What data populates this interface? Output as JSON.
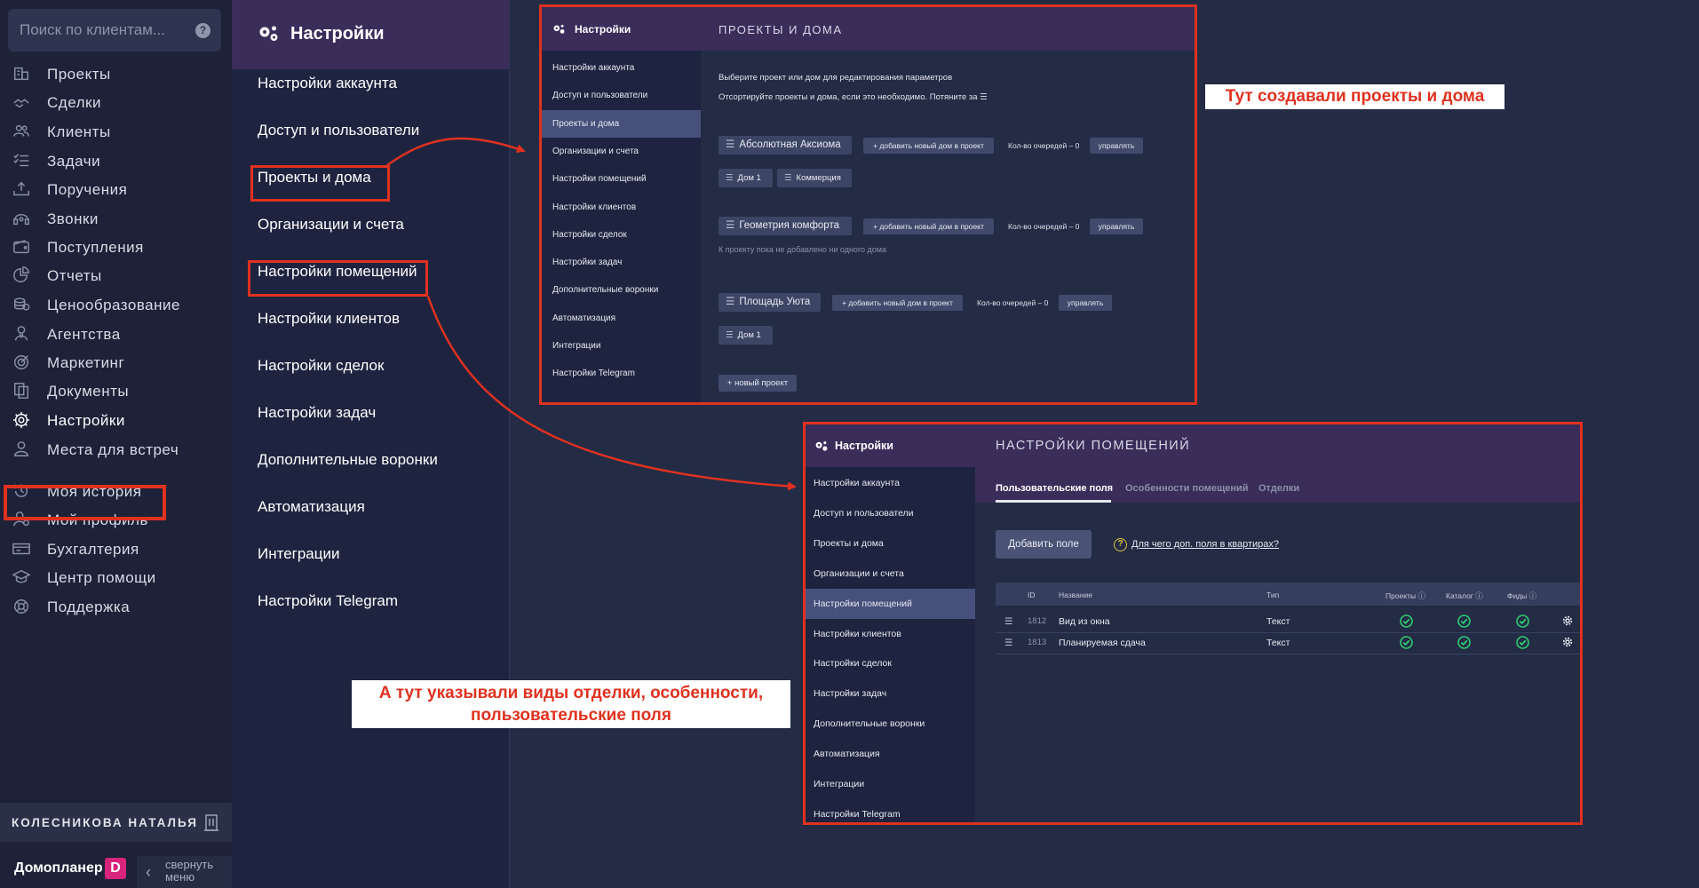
{
  "search": {
    "placeholder": "Поиск по клиентам..."
  },
  "nav": {
    "items": [
      {
        "label": "Проекты",
        "icon": "building-icon"
      },
      {
        "label": "Сделки",
        "icon": "handshake-icon"
      },
      {
        "label": "Клиенты",
        "icon": "users-icon"
      },
      {
        "label": "Задачи",
        "icon": "checklist-icon"
      },
      {
        "label": "Поручения",
        "icon": "upload-tray-icon"
      },
      {
        "label": "Звонки",
        "icon": "headset-icon"
      },
      {
        "label": "Поступления",
        "icon": "wallet-icon"
      },
      {
        "label": "Отчеты",
        "icon": "pie-chart-icon"
      },
      {
        "label": "Ценообразование",
        "icon": "coins-icon"
      },
      {
        "label": "Агентства",
        "icon": "agent-icon"
      },
      {
        "label": "Маркетинг",
        "icon": "target-icon"
      },
      {
        "label": "Документы",
        "icon": "documents-icon"
      },
      {
        "label": "Настройки",
        "icon": "gear-icon"
      },
      {
        "label": "Места для встреч",
        "icon": "meeting-icon"
      },
      {
        "label": "Моя история",
        "icon": "history-icon"
      },
      {
        "label": "Мой профиль",
        "icon": "profile-icon"
      },
      {
        "label": "Бухгалтерия",
        "icon": "cash-icon"
      },
      {
        "label": "Центр помощи",
        "icon": "graduation-cap-icon"
      },
      {
        "label": "Поддержка",
        "icon": "lifebuoy-icon"
      }
    ],
    "active": "Настройки"
  },
  "user": {
    "name": "КОЛЕСНИКОВА НАТАЛЬЯ"
  },
  "brand": {
    "name": "Домопланер",
    "logo_letter": "D",
    "collapse_label_1": "свернуть",
    "collapse_label_2": "меню"
  },
  "settings": {
    "title": "Настройки",
    "items": [
      "Настройки аккаунта",
      "Доступ и пользователи",
      "Проекты и дома",
      "Организации и счета",
      "Настройки помещений",
      "Настройки клиентов",
      "Настройки сделок",
      "Настройки задач",
      "Дополнительные воронки",
      "Автоматизация",
      "Интеграции",
      "Настройки Telegram"
    ]
  },
  "panel1": {
    "sidebar_title": "Настройки",
    "selected_item": "Проекты и дома",
    "header": "ПРОЕКТЫ И ДОМА",
    "intro_1": "Выберите проект или дом для редактирования параметров",
    "intro_2": "Отсортируйте проекты и дома, если это необходимо. Потяните за ☰",
    "add_house_label": "+ добавить новый дом в проект",
    "queue_label": "Кол-во очередей – 0",
    "manage_label": "управлять",
    "empty_note": "К проекту пока не добавлено ни одного дома",
    "new_project_label": "+ новый проект",
    "projects": [
      {
        "name": "Абсолютная Аксиома",
        "houses": [
          "Дом 1",
          "Коммерция"
        ]
      },
      {
        "name": "Геометрия комфорта",
        "houses": []
      },
      {
        "name": "Площадь Уюта",
        "houses": [
          "Дом 1"
        ]
      }
    ]
  },
  "panel2": {
    "sidebar_title": "Настройки",
    "selected_item": "Настройки помещений",
    "header": "НАСТРОЙКИ ПОМЕЩЕНИЙ",
    "tabs": [
      "Пользовательские поля",
      "Особенности помещений",
      "Отделки"
    ],
    "active_tab": "Пользовательские поля",
    "add_field_label": "Добавить поле",
    "help_link": "Для чего доп. поля в квартирах?",
    "columns": [
      "ID",
      "Название",
      "Тип",
      "Проекты ⓘ",
      "Каталог ⓘ",
      "Фиды ⓘ"
    ],
    "rows": [
      {
        "id": "1812",
        "name": "Вид из окна",
        "type": "Текст"
      },
      {
        "id": "1813",
        "name": "Планируемая сдача",
        "type": "Текст"
      }
    ]
  },
  "callouts": {
    "top": "Тут создавали проекты и дома",
    "bottom_line1": "А тут указывали виды отделки, особенности,",
    "bottom_line2": "пользовательские поля"
  },
  "colors": {
    "accent_red": "#e0311f",
    "header_purple": "#3a2d5a",
    "check_green": "#2ecc71"
  }
}
